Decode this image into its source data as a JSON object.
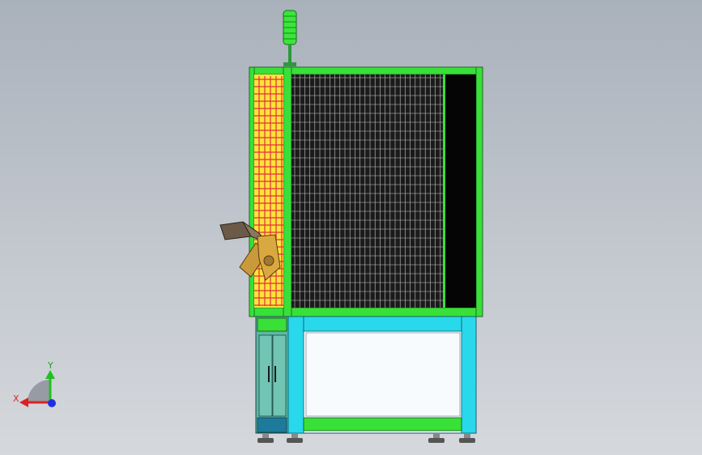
{
  "view": {
    "background_top": "#a9b1bb",
    "background_bottom": "#d5d8dc"
  },
  "model": {
    "signal_tower": {
      "light_color": "#39e639",
      "pole_color": "#2a9a3a"
    },
    "frame_color": "#38e038",
    "fence_mesh_color": "#1b1b1b",
    "safety_curtain_color": "#ffe23a",
    "curtain_grid_color": "#e0303a",
    "cabinet_color": "#5fb6a5",
    "table_frame_color": "#29d8ea",
    "table_panel_color": "#f4f8fb",
    "robot_arm_color": "#6b5a48"
  },
  "triad": {
    "x_label": "X",
    "y_label": "Y",
    "x_color": "#e02020",
    "y_color": "#20c020",
    "z_color": "#2030e0"
  }
}
